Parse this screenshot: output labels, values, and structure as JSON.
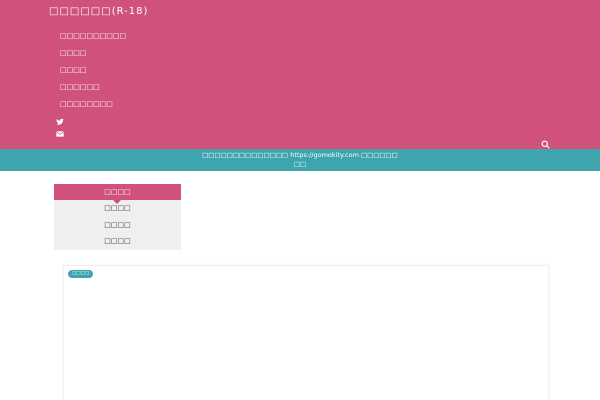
{
  "site": {
    "title": "□□□□□□(R-18)"
  },
  "nav": {
    "items": [
      {
        "label": "□□□□□□□□□□"
      },
      {
        "label": "□□□□"
      },
      {
        "label": "□□□□"
      },
      {
        "label": "□□□□□□"
      },
      {
        "label": "□□□□□□□□"
      }
    ]
  },
  "social": {
    "icons": [
      "twitter-icon",
      "mail-icon"
    ]
  },
  "notice": {
    "text_before": "□□□□□□□□□□□□□□ ",
    "url": "https://gomokity.com",
    "text_after": " □□□□□□",
    "line2": "□□"
  },
  "widget": {
    "title": "□□□□",
    "items": [
      {
        "label": "□□□□"
      },
      {
        "label": "□□□□"
      },
      {
        "label": "□□□□"
      }
    ]
  },
  "card": {
    "badge": "□□□□"
  },
  "colors": {
    "header_pink": "#d0527b",
    "notice_teal": "#3ea4ae"
  }
}
